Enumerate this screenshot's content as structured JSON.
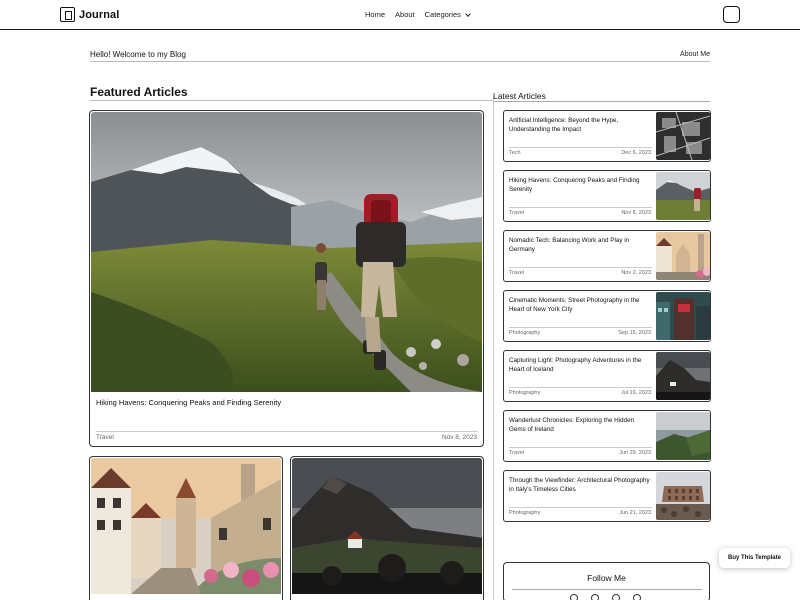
{
  "nav": {
    "brand": "Journal",
    "links": [
      "Home",
      "About",
      "Categories"
    ]
  },
  "welcome": {
    "text": "Hello! Welcome to my Blog",
    "about_link": "About Me"
  },
  "featured": {
    "heading": "Featured Articles",
    "main": {
      "title": "Hiking Havens: Conquering Peaks and Finding Serenity",
      "tag": "Travel",
      "date": "Nov 8, 2023"
    }
  },
  "latest": {
    "heading": "Latest Articles",
    "articles": [
      {
        "title": "Artificial Intelligence: Beyond the Hype, Understanding the Impact",
        "tag": "Tech",
        "date": "Dec 6, 2023",
        "thumb": "circuit-board-image"
      },
      {
        "title": "Hiking Havens: Conquering Peaks and Finding Serenity",
        "tag": "Travel",
        "date": "Nov 8, 2023",
        "thumb": "hiker-mountains-image"
      },
      {
        "title": "Nomadic Tech: Balancing Work and Play in Germany",
        "tag": "Travel",
        "date": "Nov 2, 2023",
        "thumb": "german-village-image"
      },
      {
        "title": "Cinematic Moments: Street Photography in the Heart of New York City",
        "tag": "Photography",
        "date": "Sep 15, 2023",
        "thumb": "nyc-street-image"
      },
      {
        "title": "Capturing Light: Photography Adventures in the Heart of Iceland",
        "tag": "Photography",
        "date": "Jul 19, 2023",
        "thumb": "iceland-landscape-image"
      },
      {
        "title": "Wanderlust Chronicles: Exploring the Hidden Gems of Ireland",
        "tag": "Travel",
        "date": "Jun 29, 2023",
        "thumb": "ireland-cliffs-image"
      },
      {
        "title": "Through the Viewfinder: Architectural Photography in Italy's Timeless Cities",
        "tag": "Photography",
        "date": "Jun 21, 2023",
        "thumb": "colosseum-image"
      }
    ]
  },
  "follow": {
    "heading": "Follow Me",
    "icons": [
      "twitter-icon",
      "instagram-icon",
      "tiktok-icon",
      "facebook-icon"
    ]
  },
  "buy_button": "Buy This Template"
}
